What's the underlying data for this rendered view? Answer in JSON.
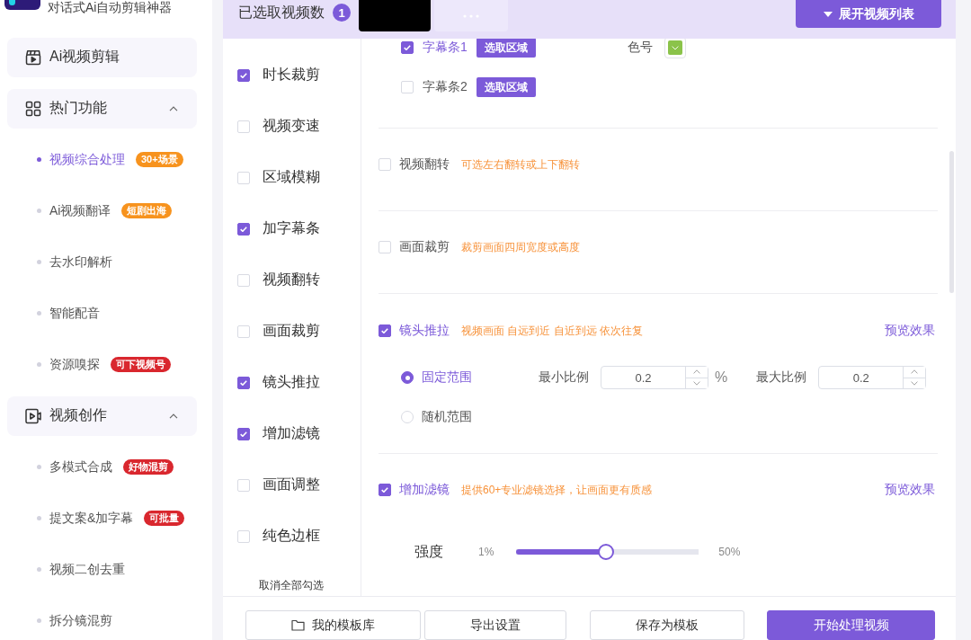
{
  "sidebar": {
    "tagline": "对话式Ai自动剪辑神器",
    "items": [
      {
        "kind": "link",
        "label": "Ai视频剪辑"
      },
      {
        "kind": "group",
        "label": "热门功能",
        "expanded": true,
        "children": [
          {
            "label": "视频综合处理",
            "selected": true,
            "badge": {
              "text": "30+场景",
              "color": "#f7931e"
            }
          },
          {
            "label": "Ai视频翻译",
            "selected": false,
            "badge": {
              "text": "短剧出海",
              "color": "#f7931e"
            }
          },
          {
            "label": "去水印解析",
            "selected": false
          },
          {
            "label": "智能配音",
            "selected": false
          },
          {
            "label": "资源嗅探",
            "selected": false,
            "badge": {
              "text": "可下视频号",
              "color": "#d9272e"
            }
          }
        ]
      },
      {
        "kind": "group",
        "label": "视频创作",
        "expanded": true,
        "children": [
          {
            "label": "多模式合成",
            "selected": false,
            "badge": {
              "text": "好物混剪",
              "color": "#d9272e"
            }
          },
          {
            "label": "提文案&加字幕",
            "selected": false,
            "badge": {
              "text": "可批量",
              "color": "#d9272e"
            }
          },
          {
            "label": "视频二创去重",
            "selected": false
          },
          {
            "label": "拆分镜混剪",
            "selected": false
          }
        ]
      }
    ]
  },
  "top_bar": {
    "count_label": "已选取视频数",
    "count": "1",
    "expand_button": "展开视频列表"
  },
  "functions": {
    "items": [
      {
        "label": "时长裁剪",
        "checked": true
      },
      {
        "label": "视频变速",
        "checked": false
      },
      {
        "label": "区域模糊",
        "checked": false
      },
      {
        "label": "加字幕条",
        "checked": true
      },
      {
        "label": "视频翻转",
        "checked": false
      },
      {
        "label": "画面裁剪",
        "checked": false
      },
      {
        "label": "镜头推拉",
        "checked": true
      },
      {
        "label": "增加滤镜",
        "checked": true
      },
      {
        "label": "画面调整",
        "checked": false
      },
      {
        "label": "纯色边框",
        "checked": false
      }
    ],
    "clear_link": "取消全部勾选"
  },
  "settings": [
    {
      "kind": "subtitle",
      "bars": [
        {
          "label": "字幕条1",
          "checked": true,
          "button": "选取区域",
          "color_label": "色号",
          "color": "#8bc34a"
        },
        {
          "label": "字幕条2",
          "checked": false,
          "button": "选取区域"
        }
      ]
    },
    {
      "kind": "option",
      "title": "视频翻转",
      "checked": false,
      "hint": "可选左右翻转或上下翻转"
    },
    {
      "kind": "option",
      "title": "画面裁剪",
      "checked": false,
      "hint": "裁剪画面四周宽度或高度"
    },
    {
      "kind": "zoom",
      "title": "镜头推拉",
      "checked": true,
      "hint": "视频画面 自远到近 自近到远 依次往复",
      "preview": "预览效果",
      "modes": [
        {
          "label": "固定范围",
          "selected": true,
          "range": {
            "min_label": "最小比例",
            "min_value": "0.2",
            "unit": "%",
            "max_label": "最大比例",
            "max_value": "0.2"
          }
        },
        {
          "label": "随机范围",
          "selected": false
        }
      ]
    },
    {
      "kind": "filter",
      "title": "增加滤镜",
      "checked": true,
      "hint": "提供60+专业滤镜选择，让画面更有质感",
      "preview": "预览效果",
      "strength": {
        "label": "强度",
        "min": "1%",
        "max": "50%",
        "level": 0.49
      }
    }
  ],
  "footer": {
    "buttons": [
      {
        "kind": "library",
        "label": "我的模板库"
      },
      {
        "kind": "plain",
        "label": "导出设置"
      },
      {
        "kind": "plain",
        "label": "保存为模板"
      },
      {
        "kind": "primary",
        "label": "开始处理视频"
      }
    ]
  }
}
